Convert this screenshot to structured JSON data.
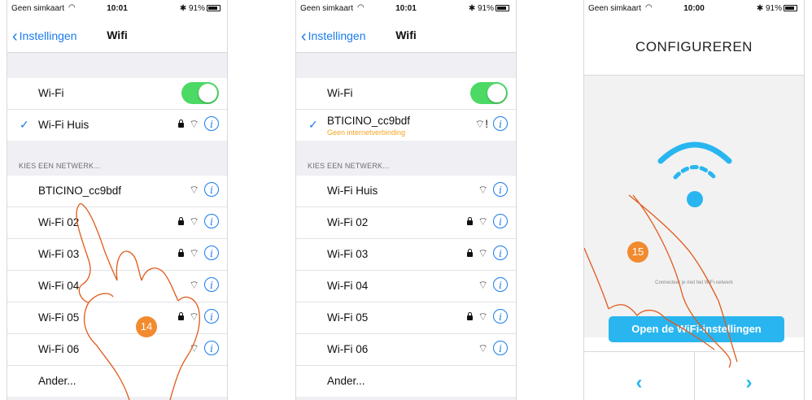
{
  "status": {
    "carrier": "Geen simkaart",
    "battery": "91%"
  },
  "phone1": {
    "time": "10:01",
    "back": "Instellingen",
    "title": "Wifi",
    "wifi_label": "Wi-Fi",
    "connected": "Wi-Fi Huis",
    "section": "KIES EEN NETWERK...",
    "networks": [
      "BTICINO_cc9bdf",
      "Wi-Fi 02",
      "Wi-Fi 03",
      "Wi-Fi 04",
      "Wi-Fi 05",
      "Wi-Fi 06"
    ],
    "other": "Ander...",
    "step": "14"
  },
  "phone2": {
    "time": "10:01",
    "back": "Instellingen",
    "title": "Wifi",
    "wifi_label": "Wi-Fi",
    "connected": "BTICINO_cc9bdf",
    "connected_sub": "Geen internetverbinding",
    "section": "KIES EEN NETWERK...",
    "networks": [
      "Wi-Fi Huis",
      "Wi-Fi 02",
      "Wi-Fi 03",
      "Wi-Fi 04",
      "Wi-Fi 05",
      "Wi-Fi 06"
    ],
    "other": "Ander..."
  },
  "phone3": {
    "time": "10:00",
    "title": "CONFIGUREREN",
    "hint": "Connecteer je met het WiFi-netwerk",
    "button": "Open de WiFi-instellingen",
    "step": "15"
  },
  "colors": {
    "ios_blue": "#1a7bf0",
    "toggle_green": "#4cd964",
    "accent_cyan": "#29b6f0",
    "step_badge": "#f28a2e",
    "warning": "#f5a623"
  }
}
